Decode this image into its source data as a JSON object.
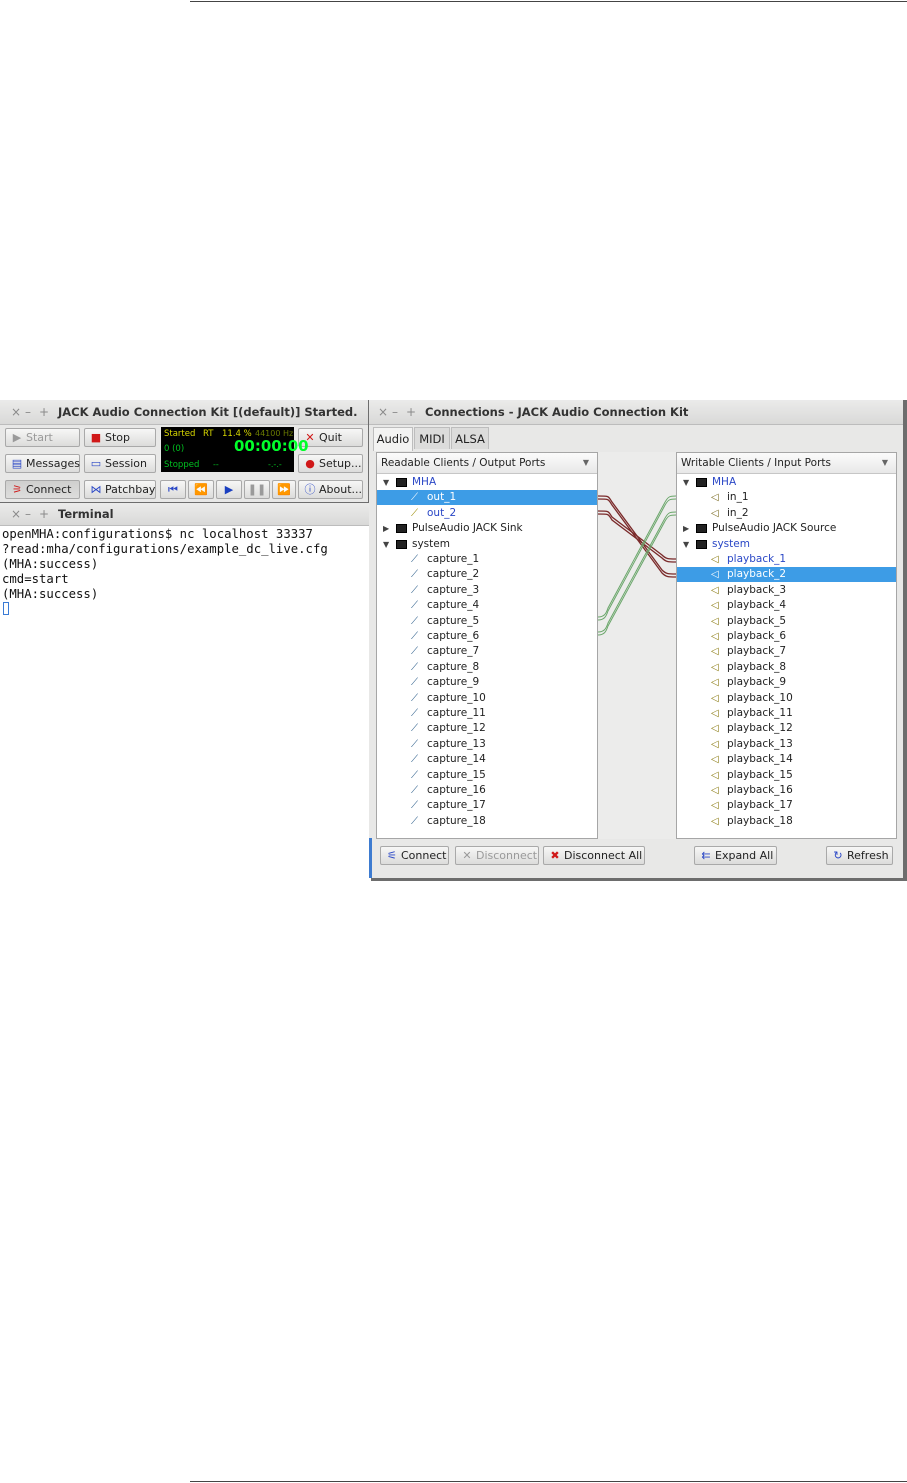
{
  "jack": {
    "title": "JACK Audio Connection Kit [(default)] Started.",
    "buttons": {
      "start": "Start",
      "stop": "Stop",
      "quit": "Quit",
      "messages": "Messages",
      "session": "Session",
      "setup": "Setup...",
      "connect": "Connect",
      "patchbay": "Patchbay",
      "about": "About..."
    },
    "status": {
      "state": "Started",
      "rt": "RT",
      "dsp": "11.4 %",
      "rate": "44100 Hz",
      "xruns": "0 (0)",
      "time": "00:00:00",
      "transport": "Stopped",
      "dash1": "--",
      "dash2": "-.-.-"
    }
  },
  "terminal": {
    "title": "Terminal",
    "lines": [
      "openMHA:configurations$ nc localhost 33337",
      "?read:mha/configurations/example_dc_live.cfg",
      "(MHA:success)",
      "cmd=start",
      "(MHA:success)"
    ]
  },
  "connections": {
    "title": "Connections - JACK Audio Connection Kit",
    "tabs": [
      "Audio",
      "MIDI",
      "ALSA"
    ],
    "left_header": "Readable Clients / Output Ports",
    "right_header": "Writable Clients / Input Ports",
    "left_tree": {
      "mha": "MHA",
      "mha_ports": [
        "out_1",
        "out_2"
      ],
      "pulse": "PulseAudio JACK Sink",
      "system": "system",
      "system_ports": [
        "capture_1",
        "capture_2",
        "capture_3",
        "capture_4",
        "capture_5",
        "capture_6",
        "capture_7",
        "capture_8",
        "capture_9",
        "capture_10",
        "capture_11",
        "capture_12",
        "capture_13",
        "capture_14",
        "capture_15",
        "capture_16",
        "capture_17",
        "capture_18"
      ]
    },
    "right_tree": {
      "mha": "MHA",
      "mha_ports": [
        "in_1",
        "in_2"
      ],
      "pulse": "PulseAudio JACK Source",
      "system": "system",
      "system_ports": [
        "playback_1",
        "playback_2",
        "playback_3",
        "playback_4",
        "playback_5",
        "playback_6",
        "playback_7",
        "playback_8",
        "playback_9",
        "playback_10",
        "playback_11",
        "playback_12",
        "playback_13",
        "playback_14",
        "playback_15",
        "playback_16",
        "playback_17",
        "playback_18"
      ]
    },
    "buttons": {
      "connect": "Connect",
      "disconnect": "Disconnect",
      "disconnect_all": "Disconnect All",
      "expand_all": "Expand All",
      "refresh": "Refresh"
    }
  },
  "colors": {
    "selection": "#3d9ce6",
    "link_red": "#7a2a2a",
    "link_green": "#6aa66a",
    "lcd_green": "#00ff2a",
    "lcd_yellow": "#d9d900"
  }
}
